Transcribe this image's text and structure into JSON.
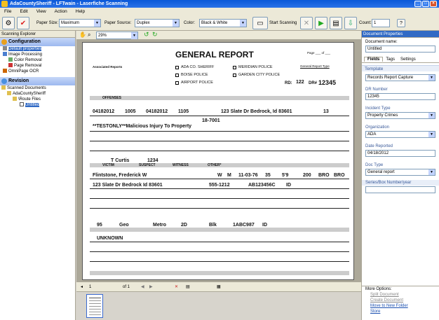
{
  "window": {
    "title": "AdaCountySheriff - LFTwain - Laserfiche Scanning"
  },
  "menu": [
    "File",
    "Edit",
    "View",
    "Action",
    "Help"
  ],
  "toolbar": {
    "paper_size_label": "Paper Size:",
    "paper_size_value": "Maximum",
    "paper_source_label": "Paper Source:",
    "paper_source_value": "Duplex",
    "color_label": "Color:",
    "color_value": "Black & White",
    "start_label": "Start Scanning",
    "count_label": "Count:",
    "count_value": "1"
  },
  "left": {
    "pane_title": "Scanning Explorer",
    "config_title": "Configuration",
    "config_items": [
      "Default properties",
      "Image Processing",
      "Color Removal",
      "Page Removal",
      "OmniPage OCR"
    ],
    "revision_title": "Revision",
    "revision_items": [
      "Scanned Documents",
      "AdaCountySheriff",
      "\\Route Files",
      "Untitled"
    ]
  },
  "viewer": {
    "zoom": "29%",
    "page_current": "1",
    "page_total": "of 1"
  },
  "form": {
    "title": "GENERAL REPORT",
    "page_of": "Page ___ of ___",
    "agency1": "ADA CO. SHERIFF",
    "agency2": "BOISE POLICE",
    "agency3": "AIRPORT POLICE",
    "agency4": "MERIDIAN POLICE",
    "agency5": "GARDEN CITY POLICE",
    "report_type": "General Report Type",
    "rd_label": "RD:",
    "rd_value": "122",
    "dr_label": "DR#",
    "dr_value": "12345",
    "assoc_reports": "Associated Reports",
    "offenses_hdr": "OFFENSES",
    "date1": "04182012",
    "time1": "1005",
    "date2": "04182012",
    "time2": "1105",
    "location": "123 Slate Dr  Bedrock, Id 83601",
    "loc_code": "13",
    "offense1": "18-7001",
    "offense_desc": "**TESTONLY**Malicious Injury To Property",
    "officer": "T Curtis",
    "badge": "1234",
    "victim_hdr": "VICTIM",
    "suspect_hdr": "SUSPECT",
    "witness_hdr": "WITNESS",
    "other_hdr": "OTHER*",
    "name": "Flintstone, Frederick W",
    "race": "W",
    "sex": "M",
    "dob": "11-03-76",
    "age": "35",
    "height": "5'9",
    "weight": "200",
    "hair": "BRO",
    "eyes": "BRO",
    "address": "123 Slate Dr  Bedrock Id  83601",
    "phone": "555-1212",
    "oln": "AB123456C",
    "oln_state": "ID",
    "veh_year": "95",
    "veh_make": "Geo",
    "veh_model": "Metro",
    "veh_style": "2D",
    "veh_color": "Blk",
    "veh_lic": "1ABC987",
    "veh_state": "ID",
    "name2": "UNKNOWN"
  },
  "right": {
    "title": "Document Properties",
    "doc_name_label": "Document name:",
    "doc_name_value": "Untitled",
    "tabs": [
      "Fields",
      "Tags",
      "Settings"
    ],
    "template_label": "Template",
    "template_value": "Records Report Capture",
    "dr_label": "DR Number",
    "dr_value": "12345",
    "incident_label": "Incident Type",
    "incident_value": "Property Crimes",
    "org_label": "Organization",
    "org_value": "ADA",
    "date_label": "Date Reported",
    "date_value": "04/18/2012",
    "doctype_label": "Doc Type",
    "doctype_value": "General report",
    "series_label": "Series/Box Number/year",
    "series_value": "",
    "more_label": "More Options:",
    "more_items": [
      "Split Document",
      "Create Document",
      "Move to New Folder",
      "Store"
    ]
  }
}
